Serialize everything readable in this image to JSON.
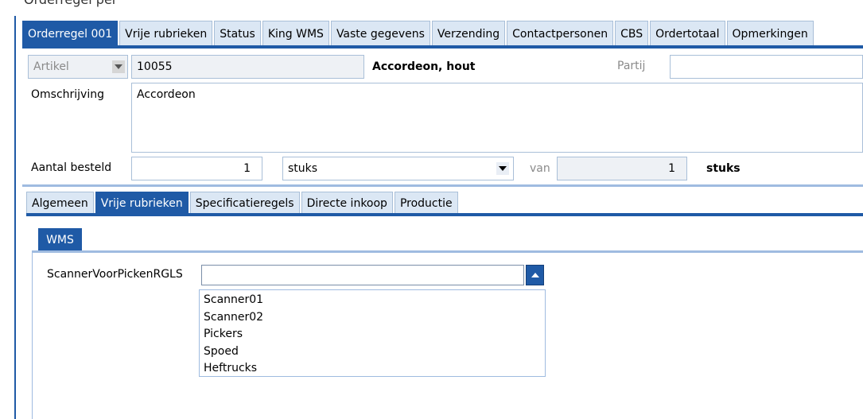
{
  "header_fragment": "Orderregel per",
  "top_tabs": [
    "Orderregel 001",
    "Vrije rubrieken",
    "Status",
    "King WMS",
    "Vaste gegevens",
    "Verzending",
    "Contactpersonen",
    "CBS",
    "Ordertotaal",
    "Opmerkingen"
  ],
  "artikel": {
    "label": "Artikel",
    "code": "10055",
    "description": "Accordeon, hout"
  },
  "partij": {
    "label": "Partij",
    "value": ""
  },
  "omschrijving": {
    "label": "Omschrijving",
    "value": "Accordeon"
  },
  "aantal": {
    "label": "Aantal besteld",
    "value": "1",
    "unit": "stuks",
    "van_label": "van",
    "van_value": "1",
    "van_unit": "stuks"
  },
  "lower_tabs": [
    "Algemeen",
    "Vrije rubrieken",
    "Specificatieregels",
    "Directe inkoop",
    "Productie"
  ],
  "wms_tab": "WMS",
  "scanner": {
    "label": "ScannerVoorPickenRGLS",
    "value": "",
    "options": [
      "Scanner01",
      "Scanner02",
      "Pickers",
      "Spoed",
      "Heftrucks"
    ]
  },
  "colors": {
    "accent": "#1f5aa6",
    "tab_bg": "#dbe7f4",
    "border": "#a9bfd8"
  }
}
